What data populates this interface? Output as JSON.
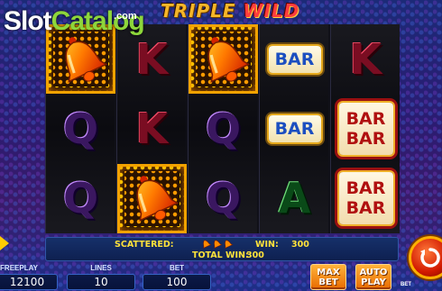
{
  "logo": {
    "slot": "Slot",
    "catalog": "Catalog",
    "com": ".com"
  },
  "game_title": {
    "part1": "TRIPLE",
    "part2": "WILD"
  },
  "reels": [
    [
      "bell",
      "Q",
      "Q"
    ],
    [
      "K",
      "K",
      "bell"
    ],
    [
      "bell",
      "Q",
      "Q"
    ],
    [
      "BAR",
      "BAR",
      "A"
    ],
    [
      "K",
      "BARBAR",
      "BARBAR"
    ]
  ],
  "symbols": {
    "bar_single": "BAR",
    "bar_double_top": "BAR",
    "bar_double_bottom": "BAR"
  },
  "info": {
    "scattered_label": "SCATTERED:",
    "scatter_icons": [
      "bell-icon",
      "bell-icon",
      "bell-icon"
    ],
    "win_label": "WIN:",
    "win_value": "300",
    "total_win_label": "TOTAL WIN:",
    "total_win_value": "300"
  },
  "stats": {
    "freeplay_label": "FREEPLAY",
    "freeplay_value": "12100",
    "lines_label": "LINES",
    "lines_value": "10",
    "bet_label": "BET",
    "bet_value": "100"
  },
  "buttons": {
    "max_bet_line1": "MAX",
    "max_bet_line2": "BET",
    "auto_play_line1": "AUTO",
    "auto_play_line2": "PLAY",
    "bet_tag": "BET",
    "spin_icon": "spin-icon"
  },
  "colors": {
    "accent_yellow": "#ffe23a",
    "button_orange": "#f08a10",
    "spin_red": "#d21a00"
  }
}
